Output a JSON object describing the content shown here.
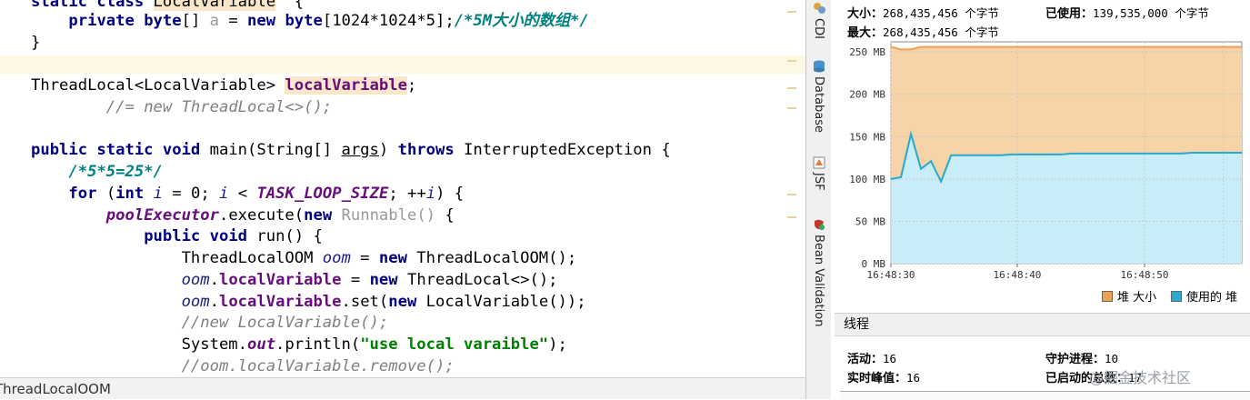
{
  "editor": {
    "lines": [
      [
        [
          "kw",
          "static class "
        ],
        [
          "decl-hl",
          "LocalVariable"
        ],
        [
          "",
          "  {"
        ]
      ],
      [
        [
          "",
          "    "
        ],
        [
          "kw",
          "private byte"
        ],
        [
          "",
          "[] "
        ],
        [
          "fld-n",
          "a"
        ],
        [
          "",
          " = "
        ],
        [
          "kw",
          "new byte"
        ],
        [
          "",
          "[1024*1024*5];"
        ],
        [
          "cmt-b",
          "/*5M大小的数组*/"
        ]
      ],
      [
        [
          "",
          "}"
        ]
      ],
      [
        [
          "",
          ""
        ]
      ],
      [
        [
          "",
          "ThreadLocal<LocalVariable> "
        ],
        [
          "fld decl-hl",
          "localVariable"
        ],
        [
          "",
          ";"
        ]
      ],
      [
        [
          "",
          "        "
        ],
        [
          "cmt",
          "//= new ThreadLocal<>();"
        ]
      ],
      [
        [
          "",
          ""
        ]
      ],
      [
        [
          "kw",
          "public static void "
        ],
        [
          "",
          "main(String[] "
        ],
        [
          "ul",
          "args"
        ],
        [
          "",
          ") "
        ],
        [
          "kw",
          "throws "
        ],
        [
          "",
          "InterruptedException {"
        ]
      ],
      [
        [
          "",
          "    "
        ],
        [
          "cmt-b",
          "/*5*5=25*/"
        ]
      ],
      [
        [
          "",
          "    "
        ],
        [
          "kw",
          "for "
        ],
        [
          "",
          "("
        ],
        [
          "kw",
          "int "
        ],
        [
          "var",
          "i"
        ],
        [
          "",
          " = "
        ],
        [
          "",
          "0"
        ],
        [
          "",
          "; "
        ],
        [
          "var",
          "i"
        ],
        [
          "",
          " < "
        ],
        [
          "fld-i",
          "TASK_LOOP_SIZE"
        ],
        [
          "",
          "; ++"
        ],
        [
          "var",
          "i"
        ],
        [
          "",
          ") {"
        ]
      ],
      [
        [
          "",
          "        "
        ],
        [
          "fld-i",
          "poolExecutor"
        ],
        [
          "",
          ".execute("
        ],
        [
          "kw",
          "new "
        ],
        [
          "gray",
          "Runnable() "
        ],
        [
          "",
          "{"
        ]
      ],
      [
        [
          "",
          "            "
        ],
        [
          "kw",
          "public void "
        ],
        [
          "",
          "run() {"
        ]
      ],
      [
        [
          "",
          "                ThreadLocalOOM "
        ],
        [
          "var",
          "oom"
        ],
        [
          "",
          " = "
        ],
        [
          "kw",
          "new "
        ],
        [
          "",
          "ThreadLocalOOM();"
        ]
      ],
      [
        [
          "",
          "                "
        ],
        [
          "var",
          "oom"
        ],
        [
          "",
          "."
        ],
        [
          "fld",
          "localVariable"
        ],
        [
          "",
          " = "
        ],
        [
          "kw",
          "new "
        ],
        [
          "",
          "ThreadLocal<>();"
        ]
      ],
      [
        [
          "",
          "                "
        ],
        [
          "var",
          "oom"
        ],
        [
          "",
          "."
        ],
        [
          "fld",
          "localVariable"
        ],
        [
          "",
          ".set("
        ],
        [
          "kw",
          "new "
        ],
        [
          "",
          "LocalVariable());"
        ]
      ],
      [
        [
          "",
          "                "
        ],
        [
          "cmt",
          "//new LocalVariable();"
        ]
      ],
      [
        [
          "",
          "                System."
        ],
        [
          "fld-i",
          "out"
        ],
        [
          "",
          ".println("
        ],
        [
          "str",
          "\"use local varaible\""
        ],
        [
          "",
          ");"
        ]
      ],
      [
        [
          "",
          "                "
        ],
        [
          "cmt",
          "//oom.localVariable.remove();"
        ]
      ]
    ],
    "status_text": "ThreadLocalOOM"
  },
  "toolstrip": [
    {
      "label": "CDI",
      "icon": "cdi-icon",
      "color": "#6a9bd1"
    },
    {
      "label": "Database",
      "icon": "database-icon",
      "color": "#4a90c8"
    },
    {
      "label": "JSF",
      "icon": "jsf-icon",
      "color": "#e07b39"
    },
    {
      "label": "Bean Validation",
      "icon": "bean-validation-icon",
      "color": "#c0392b"
    }
  ],
  "heap": {
    "size_label": "大小：",
    "size_value": "268,435,456 个字节",
    "max_label": "最大：",
    "max_value": "268,435,456 个字节",
    "used_label": "已使用：",
    "used_value": "139,535,000 个字节"
  },
  "chart_data": {
    "type": "area",
    "x_ticks": [
      "16:48:30",
      "16:48:40",
      "16:48:50"
    ],
    "y_ticks": [
      "0 MB",
      "50 MB",
      "100 MB",
      "150 MB",
      "200 MB",
      "250 MB"
    ],
    "ylim": [
      0,
      262
    ],
    "series": [
      {
        "name": "堆 大小",
        "color": "#f0a050",
        "fill": "#f7d3a8",
        "x": [
          0,
          1,
          2,
          3,
          4,
          5,
          6,
          7,
          8,
          9,
          10,
          11,
          12,
          13,
          14,
          15,
          16,
          17,
          18,
          19,
          20,
          21,
          22,
          23,
          24,
          25,
          26,
          27,
          28,
          29,
          30,
          31,
          32,
          33,
          34,
          35
        ],
        "values": [
          256,
          253,
          253,
          256,
          256,
          256,
          256,
          256,
          256,
          256,
          256,
          256,
          256,
          256,
          256,
          256,
          256,
          256,
          256,
          256,
          256,
          256,
          256,
          256,
          256,
          256,
          256,
          256,
          256,
          256,
          256,
          256,
          256,
          256,
          256,
          256
        ]
      },
      {
        "name": "使用的 堆",
        "color": "#29a8d0",
        "fill": "#c8ecf8",
        "x": [
          0,
          1,
          2,
          3,
          4,
          5,
          6,
          7,
          8,
          9,
          10,
          11,
          12,
          13,
          14,
          15,
          16,
          17,
          18,
          19,
          20,
          21,
          22,
          23,
          24,
          25,
          26,
          27,
          28,
          29,
          30,
          31,
          32,
          33,
          34,
          35
        ],
        "values": [
          100,
          102,
          153,
          112,
          121,
          97,
          128,
          128,
          128,
          128,
          128,
          128,
          129,
          129,
          129,
          129,
          129,
          129,
          130,
          130,
          130,
          130,
          130,
          130,
          130,
          130,
          130,
          130,
          130,
          130,
          131,
          131,
          131,
          131,
          131,
          131
        ]
      }
    ]
  },
  "threads": {
    "title": "线程",
    "live_label": "活动：",
    "live_value": "16",
    "peak_label": "实时峰值：",
    "peak_value": "16",
    "daemon_label": "守护进程：",
    "daemon_value": "10",
    "started_label": "已启动的总数：",
    "started_value": "17"
  },
  "watermark": "@掘金技术社区"
}
